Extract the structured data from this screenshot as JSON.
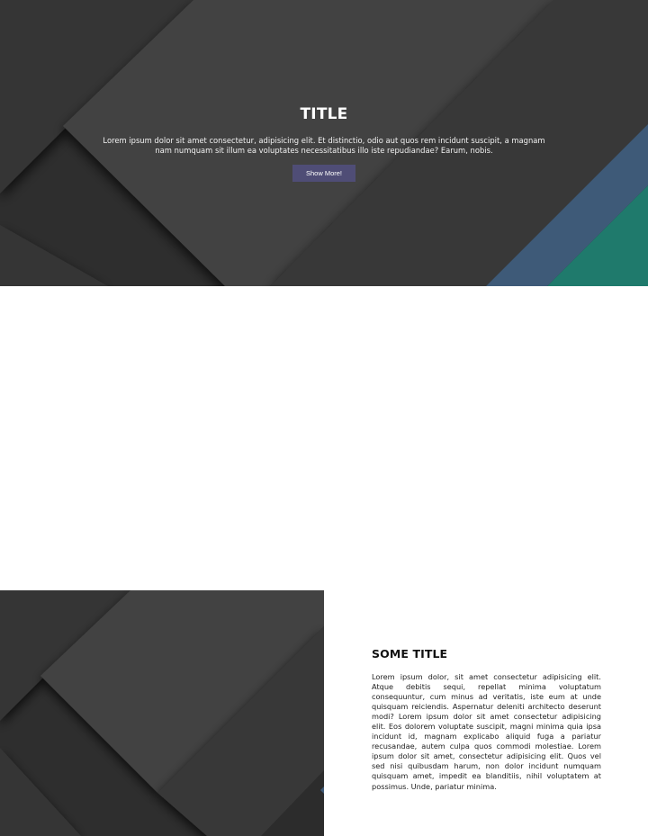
{
  "hero": {
    "title": "TITLE",
    "text": "Lorem ipsum dolor sit amet consectetur, adipisicing elit. Et distinctio, odio aut quos rem incidunt suscipit, a magnam nam numquam sit illum ea voluptates necessitatibus illo iste repudiandae? Earum, nobis.",
    "button_label": "Show More!"
  },
  "feature": {
    "title": "SOME TITLE",
    "text": "Lorem ipsum dolor, sit amet consectetur adipisicing elit. Atque debitis sequi, repellat minima voluptatum consequuntur, cum minus ad veritatis, iste eum at unde quisquam reiciendis. Aspernatur deleniti architecto deserunt modi? Lorem ipsum dolor sit amet consectetur adipisicing elit. Eos dolorem voluptate suscipit, magni minima quia ipsa incidunt id, magnam explicabo aliquid fuga a pariatur recusandae, autem culpa quos commodi molestiae. Lorem ipsum dolor sit amet, consectetur adipisicing elit. Quos vel sed nisi quibusdam harum, non dolor incidunt numquam quisquam amet, impedit ea blanditiis, nihil voluptatem at possimus. Unde, pariatur minima."
  },
  "colors": {
    "hero_background": "#2e2e2e",
    "band_light": "#424242",
    "band_mid": "#383838",
    "accent_blue": "#3e5a78",
    "accent_teal": "#1f7a6c",
    "button": "#4f4d76",
    "page_background": "#ffffff"
  }
}
